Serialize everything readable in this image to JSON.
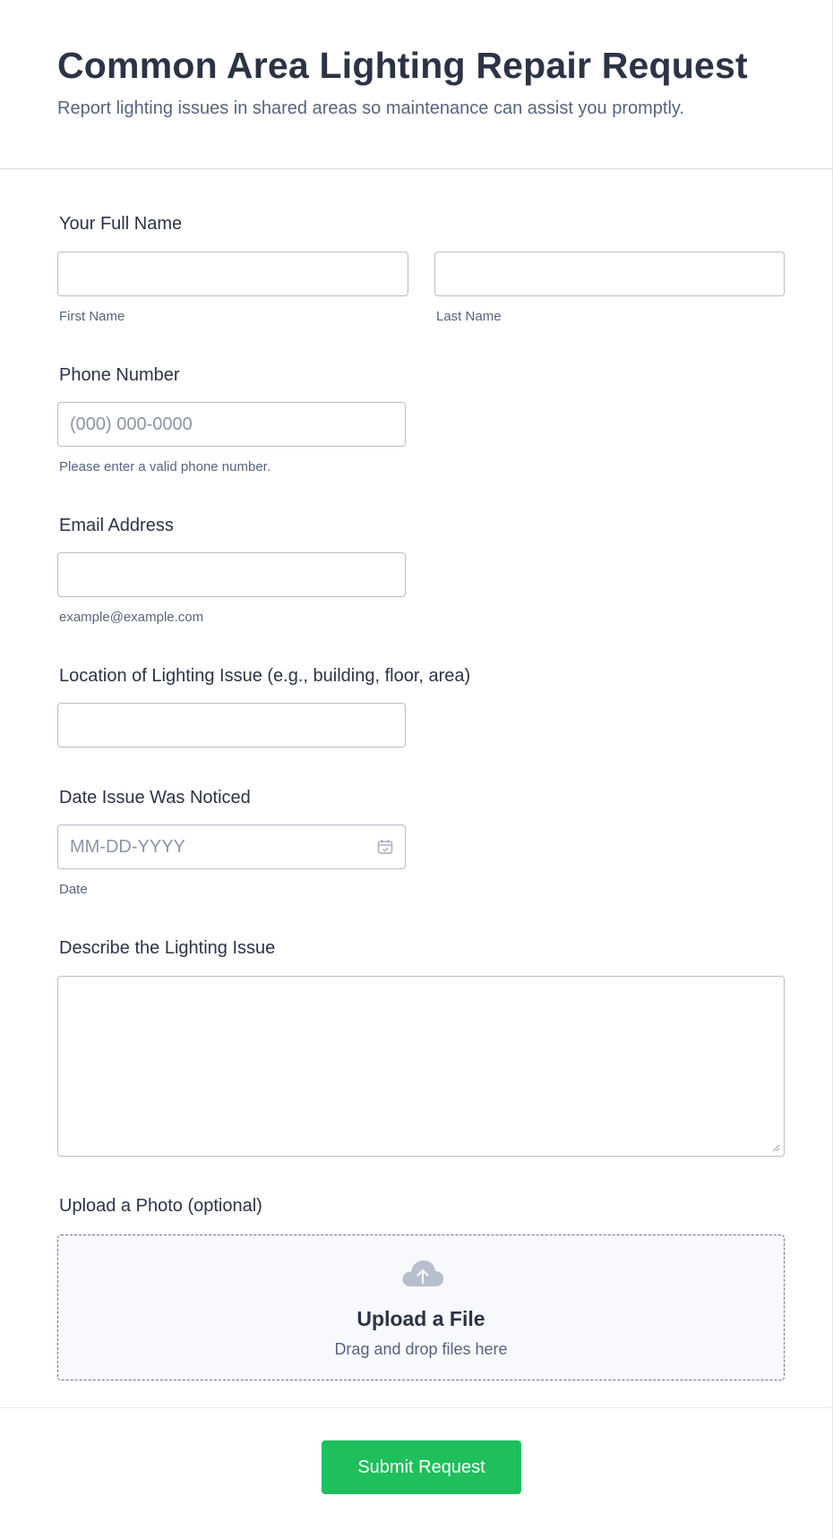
{
  "header": {
    "title": "Common Area Lighting Repair Request",
    "subtitle": "Report lighting issues in shared areas so maintenance can assist you promptly."
  },
  "fields": {
    "name": {
      "label": "Your Full Name",
      "first_sublabel": "First Name",
      "last_sublabel": "Last Name",
      "first_value": "",
      "last_value": ""
    },
    "phone": {
      "label": "Phone Number",
      "placeholder": "(000) 000-0000",
      "hint": "Please enter a valid phone number."
    },
    "email": {
      "label": "Email Address",
      "hint": "example@example.com",
      "value": ""
    },
    "location": {
      "label": "Location of Lighting Issue (e.g., building, floor, area)",
      "value": ""
    },
    "date": {
      "label": "Date Issue Was Noticed",
      "placeholder": "MM-DD-YYYY",
      "hint": "Date",
      "icon": "calendar-icon"
    },
    "description": {
      "label": "Describe the Lighting Issue",
      "value": ""
    },
    "upload": {
      "label": "Upload a Photo (optional)",
      "title": "Upload a File",
      "subtitle": "Drag and drop files here",
      "icon": "cloud-upload-icon"
    }
  },
  "submit": {
    "label": "Submit Request",
    "color": "#1fbf5c"
  }
}
